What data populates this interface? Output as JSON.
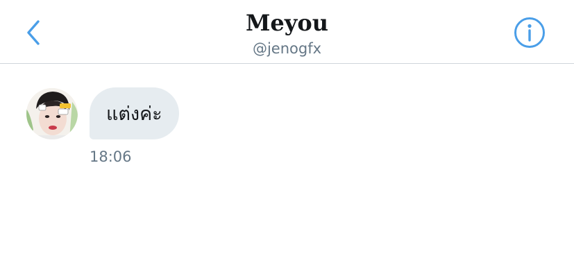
{
  "header": {
    "title": "Meyou",
    "subtitle": "@jenogfx",
    "back_icon": "chevron-left-icon",
    "info_icon": "info-icon"
  },
  "colors": {
    "accent": "#4a9ee8",
    "bubble": "#e6ecf0",
    "text": "#14171a",
    "secondary_text": "#657786",
    "divider": "#cfd5da"
  },
  "conversation": {
    "messages": [
      {
        "text": "แต่งค่ะ",
        "time": "18:06",
        "direction": "incoming"
      }
    ]
  }
}
